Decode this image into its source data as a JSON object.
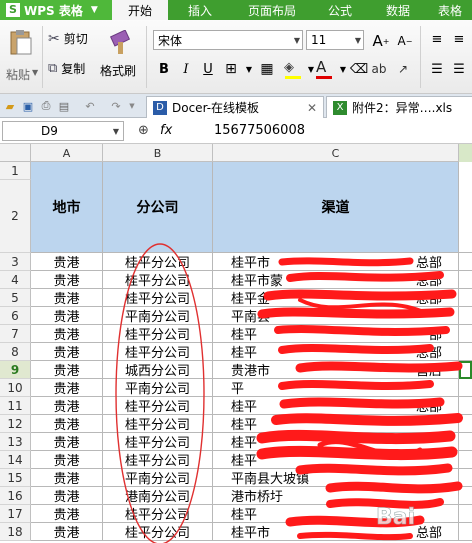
{
  "app": {
    "name": "WPS 表格",
    "logo": "S"
  },
  "menu": {
    "tabs": [
      "开始",
      "插入",
      "页面布局",
      "公式",
      "数据",
      "表格"
    ],
    "active": 0
  },
  "ribbon": {
    "paste": "粘贴",
    "cut": "剪切",
    "copy": "复制",
    "format_painter": "格式刷",
    "font_name": "宋体",
    "font_size": "11",
    "bold": "B",
    "italic": "I",
    "underline": "U"
  },
  "tabbar": {
    "tab1": "Docer-在线模板",
    "tab2": "附件2：异常….xls"
  },
  "formula": {
    "cell_ref": "D9",
    "fx": "fx",
    "value": "15677506008"
  },
  "columns": [
    "A",
    "B",
    "C"
  ],
  "header_row": {
    "row": "1",
    "row2": "2",
    "a": "地市",
    "b": "分公司",
    "c": "渠道"
  },
  "rows": [
    {
      "n": "3",
      "a": "贵港",
      "b": "桂平分公司",
      "c": "桂平市",
      "c2": "总部"
    },
    {
      "n": "4",
      "a": "贵港",
      "b": "桂平分公司",
      "c": "桂平市蒙",
      "c2": "总部"
    },
    {
      "n": "5",
      "a": "贵港",
      "b": "桂平分公司",
      "c": "桂平金",
      "c2": "总部"
    },
    {
      "n": "6",
      "a": "贵港",
      "b": "平南分公司",
      "c": "平南县",
      "c2": ""
    },
    {
      "n": "7",
      "a": "贵港",
      "b": "桂平分公司",
      "c": "桂平",
      "c2": "部"
    },
    {
      "n": "8",
      "a": "贵港",
      "b": "桂平分公司",
      "c": "桂平",
      "c2": "总部"
    },
    {
      "n": "9",
      "a": "贵港",
      "b": "城西分公司",
      "c": "贵港市",
      "c2": "营店"
    },
    {
      "n": "10",
      "a": "贵港",
      "b": "平南分公司",
      "c": "平",
      "c2": ""
    },
    {
      "n": "11",
      "a": "贵港",
      "b": "桂平分公司",
      "c": "桂平",
      "c2": "总部"
    },
    {
      "n": "12",
      "a": "贵港",
      "b": "桂平分公司",
      "c": "桂平",
      "c2": ""
    },
    {
      "n": "13",
      "a": "贵港",
      "b": "桂平分公司",
      "c": "桂平",
      "c2": ""
    },
    {
      "n": "14",
      "a": "贵港",
      "b": "桂平分公司",
      "c": "桂平",
      "c2": ""
    },
    {
      "n": "15",
      "a": "贵港",
      "b": "平南分公司",
      "c": "平南县大坡镇",
      "c2": ""
    },
    {
      "n": "16",
      "a": "贵港",
      "b": "港南分公司",
      "c": "港市桥圩",
      "c2": ""
    },
    {
      "n": "17",
      "a": "贵港",
      "b": "桂平分公司",
      "c": "桂平",
      "c2": ""
    },
    {
      "n": "18",
      "a": "贵港",
      "b": "桂平分公司",
      "c": "桂平市",
      "c2": "总部"
    }
  ],
  "watermark": "Bai",
  "colors": {
    "brand": "#3f9e2f",
    "header_fill": "#bcd5ee",
    "redaction": "#ff1a1a"
  }
}
